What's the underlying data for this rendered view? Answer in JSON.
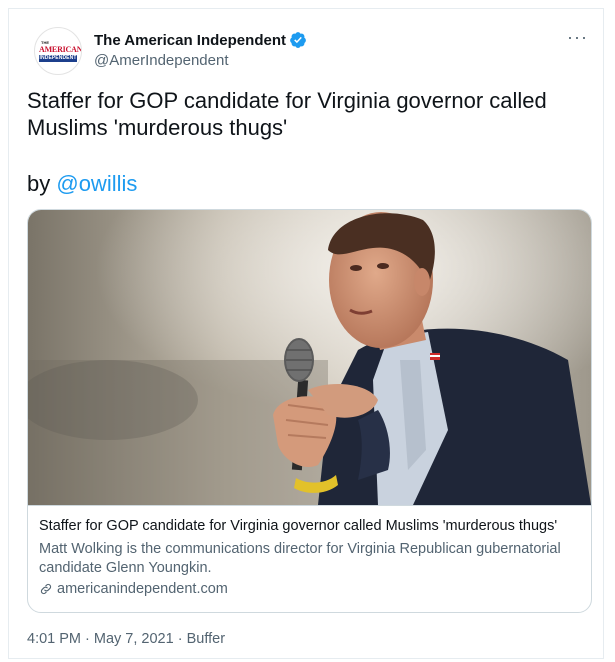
{
  "author": {
    "display_name": "The American Independent",
    "handle": "@AmerIndependent",
    "avatar_text": {
      "the": "THE",
      "american": "AMERICAN",
      "independent": "INDEPENDENT"
    },
    "verified_icon": "verified-badge-icon"
  },
  "menu": {
    "more_label": "···"
  },
  "tweet": {
    "text": "Staffer for GOP candidate for Virginia governor called Muslims 'murderous thugs'",
    "byline_prefix": "by ",
    "byline_mention": "@owillis"
  },
  "card": {
    "title": "Staffer for GOP candidate for Virginia governor called Muslims 'murderous thugs'",
    "description": "Matt Wolking is the communications director for Virginia Republican gubernatorial candidate Glenn Youngkin.",
    "domain": "americanindependent.com",
    "link_icon": "link-icon"
  },
  "meta": {
    "time": "4:01 PM",
    "separator": " · ",
    "date": "May 7, 2021",
    "source": "Buffer"
  },
  "colors": {
    "link": "#1d9bf0",
    "secondary_text": "#536471",
    "border": "#cfd9de"
  }
}
